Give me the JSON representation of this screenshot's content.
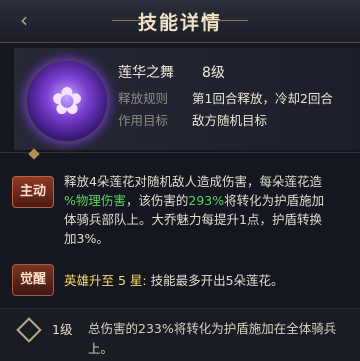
{
  "header": {
    "title": "技能详情"
  },
  "skill": {
    "name": "莲华之舞",
    "level": "8级",
    "release_rule_label": "释放规则",
    "release_rule_value": "第1回合释放，冷却2回合",
    "target_label": "作用目标",
    "target_value": "敌方随机目标",
    "icon": "lotus-icon",
    "icon_glyph": "✿"
  },
  "active": {
    "tag": "主动",
    "line1": "释放4朵莲花对随机敌人造成伤害，每朵莲花造",
    "line2_green": "%物理伤害",
    "line2_mid": "，该伤害的",
    "line2_pct": "293%",
    "line2_end": "将转化为护盾施加",
    "line3": "体骑兵部队上。大乔魅力每提升1点，护盾转换",
    "line4": "加3%。"
  },
  "awaken": {
    "tag": "觉醒",
    "title": "英雄升至 5 星:",
    "text": " 技能最多开出5朵莲花。"
  },
  "level_detail": {
    "level": "1级",
    "line1": "总伤害的233%将转化为护盾施加在全体骑兵",
    "line2": "上。"
  },
  "colors": {
    "accent_green": "#5cd35a",
    "gold": "#ffd86a"
  }
}
